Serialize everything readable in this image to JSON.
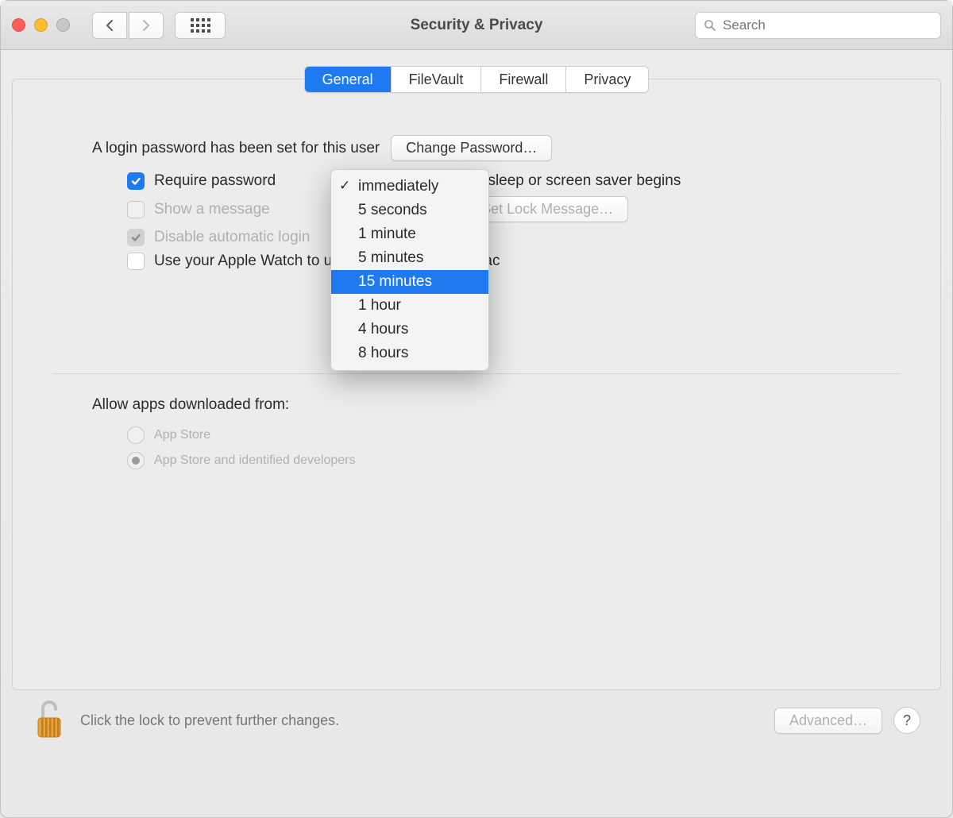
{
  "window": {
    "title": "Security & Privacy",
    "search_placeholder": "Search"
  },
  "tabs": {
    "general": "General",
    "filevault": "FileVault",
    "firewall": "Firewall",
    "privacy": "Privacy"
  },
  "general": {
    "login_text": "A login password has been set for this user",
    "change_password": "Change Password…",
    "require_prefix": "Require password",
    "require_suffix": "after sleep or screen saver begins",
    "show_message": "Show a message when the screen is locked",
    "set_lock_message": "Set Lock Message…",
    "disable_auto": "Disable automatic login",
    "apple_watch": "Use your Apple Watch to unlock apps and your Mac",
    "allow_title": "Allow apps downloaded from:",
    "allow_appstore": "App Store",
    "allow_identified": "App Store and identified developers"
  },
  "dropdown": {
    "options": [
      "immediately",
      "5 seconds",
      "1 minute",
      "5 minutes",
      "15 minutes",
      "1 hour",
      "4 hours",
      "8 hours"
    ],
    "checked_index": 0,
    "highlight_index": 4
  },
  "footer": {
    "lock_text": "Click the lock to prevent further changes.",
    "advanced": "Advanced…",
    "help": "?"
  }
}
